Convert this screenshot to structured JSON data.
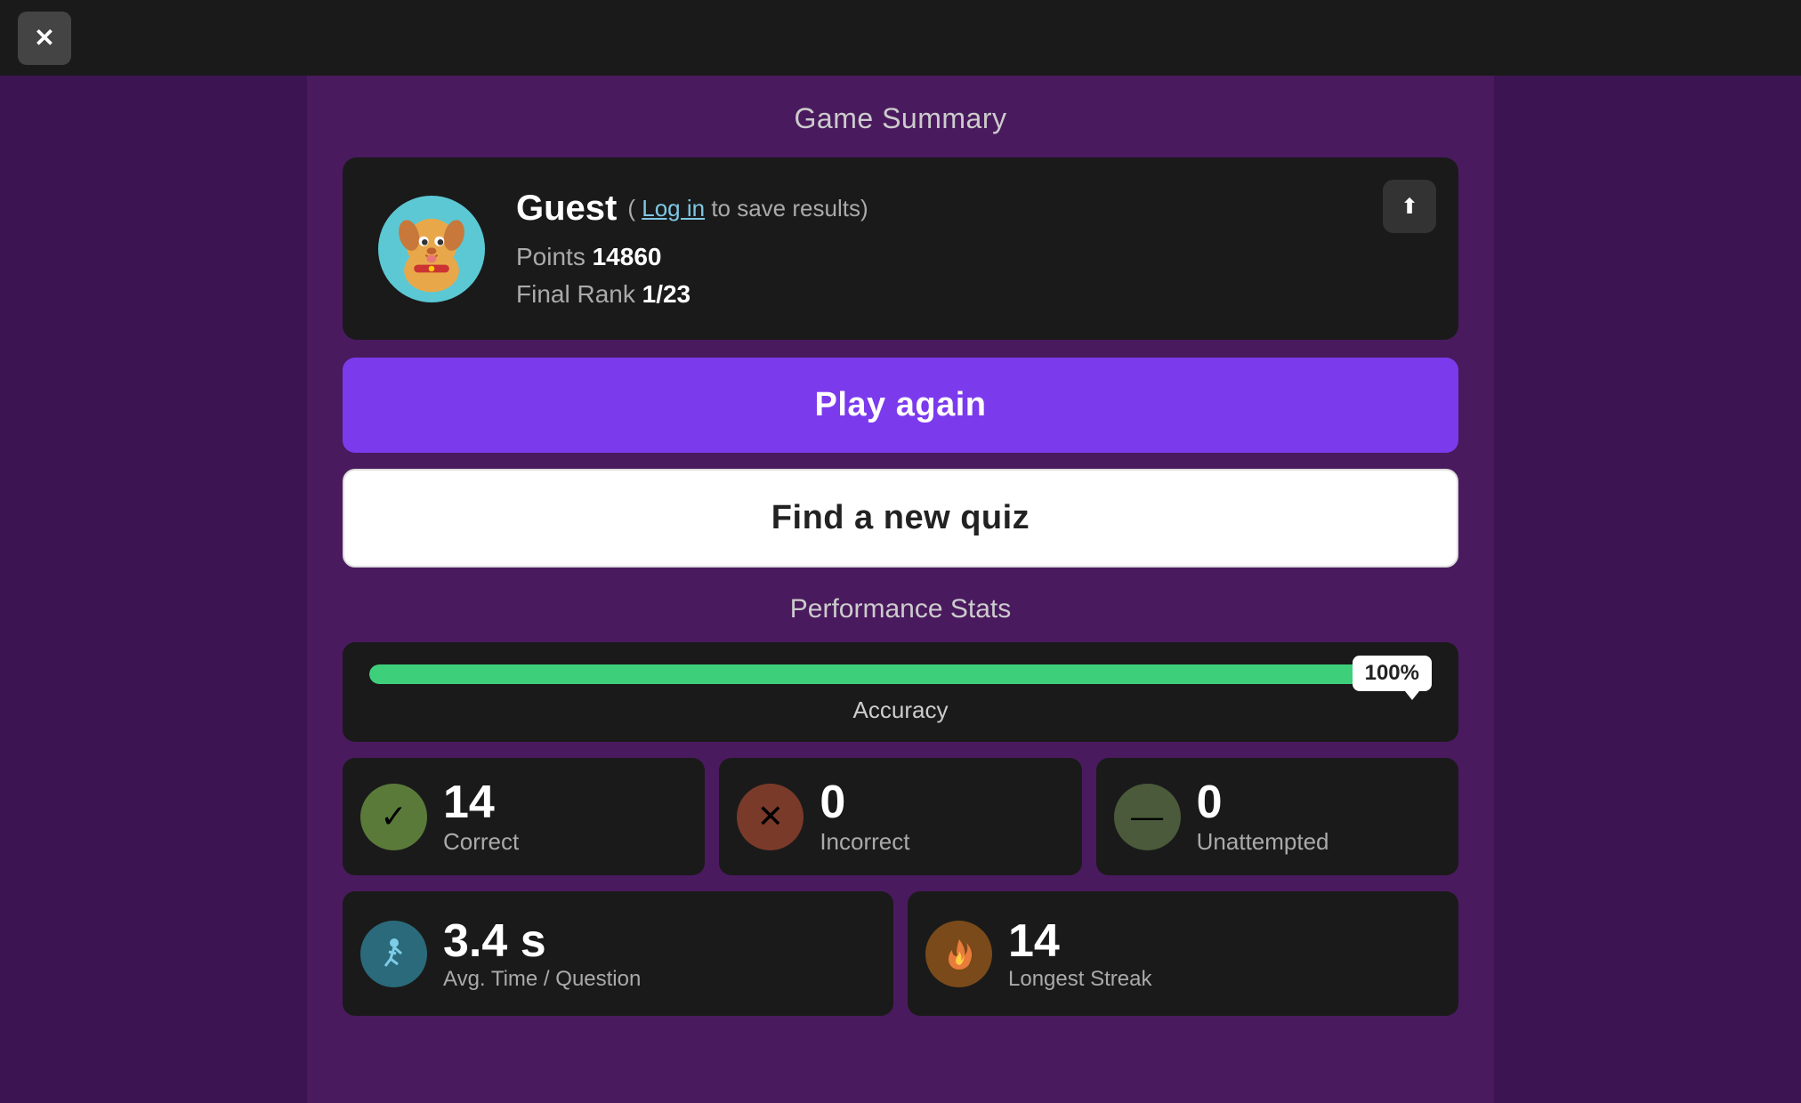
{
  "topBar": {
    "closeLabel": "✕"
  },
  "pageTitle": "Game Summary",
  "profile": {
    "name": "Guest",
    "loginText": "( ",
    "loginLinkText": "Log in",
    "loginSuffix": " to save results)",
    "pointsLabel": "Points",
    "points": "14860",
    "rankLabel": "Final Rank",
    "rank": "1/23",
    "shareIcon": "⬆"
  },
  "buttons": {
    "playAgain": "Play again",
    "findQuiz": "Find a new quiz"
  },
  "performanceStats": {
    "sectionTitle": "Performance Stats",
    "accuracy": {
      "tooltip": "100%",
      "fillPercent": 100,
      "label": "Accuracy"
    },
    "stats": [
      {
        "icon": "✓",
        "iconClass": "correct",
        "number": "14",
        "label": "Correct"
      },
      {
        "icon": "✕",
        "iconClass": "incorrect",
        "number": "0",
        "label": "Incorrect"
      },
      {
        "icon": "—",
        "iconClass": "unattempted",
        "number": "0",
        "label": "Unattempted"
      }
    ],
    "bottomStats": [
      {
        "iconClass": "time",
        "number": "3.4 s",
        "label": "Avg. Time / Question"
      },
      {
        "iconClass": "streak",
        "number": "14",
        "label": "Longest Streak"
      }
    ]
  }
}
